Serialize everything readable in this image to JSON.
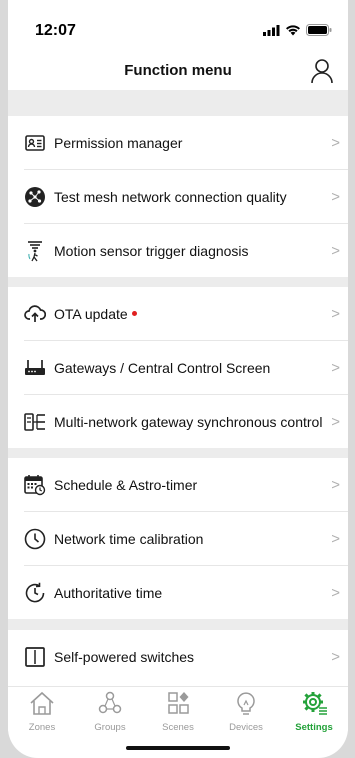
{
  "status_bar": {
    "time": "12:07"
  },
  "header": {
    "title": "Function menu"
  },
  "sections": [
    {
      "items": [
        {
          "icon": "id-card-icon",
          "label": "Permission manager"
        },
        {
          "icon": "globe-network-icon",
          "label": "Test mesh network connection quality"
        },
        {
          "icon": "motion-sensor-icon",
          "label": "Motion sensor trigger diagnosis"
        }
      ]
    },
    {
      "items": [
        {
          "icon": "cloud-upload-icon",
          "label": "OTA update",
          "badge": "red-dot"
        },
        {
          "icon": "gateway-icon",
          "label": "Gateways / Central Control Screen"
        },
        {
          "icon": "multi-gateway-icon",
          "label": "Multi-network gateway synchronous control"
        }
      ]
    },
    {
      "items": [
        {
          "icon": "calendar-clock-icon",
          "label": "Schedule & Astro-timer"
        },
        {
          "icon": "clock-icon",
          "label": "Network time calibration"
        },
        {
          "icon": "time-refresh-icon",
          "label": "Authoritative time"
        }
      ]
    },
    {
      "items": [
        {
          "icon": "panel-switch-icon",
          "label": "Self-powered switches"
        }
      ]
    }
  ],
  "chevron": ">",
  "tab_bar": {
    "tabs": [
      {
        "icon": "home-icon",
        "label": "Zones"
      },
      {
        "icon": "groups-icon",
        "label": "Groups"
      },
      {
        "icon": "scenes-icon",
        "label": "Scenes"
      },
      {
        "icon": "bulb-icon",
        "label": "Devices"
      },
      {
        "icon": "settings-gear-icon",
        "label": "Settings"
      }
    ],
    "active": "Settings",
    "active_color": "#24a23a",
    "inactive_color": "#9a9a9a"
  },
  "colors": {
    "badge": "#e02020",
    "section_gap": "#ececec"
  }
}
